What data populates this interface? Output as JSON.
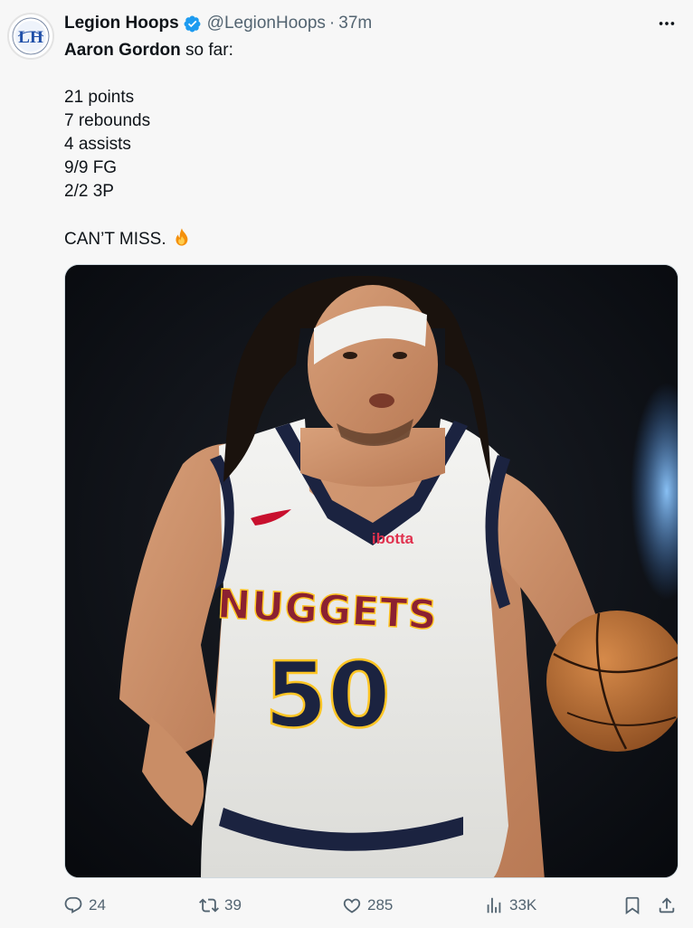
{
  "author": {
    "display_name": "Legion Hoops",
    "handle": "@LegionHoops",
    "separator": "·",
    "time": "37m",
    "avatar_icon": "legion-hoops-logo",
    "avatar_monogram": "LH",
    "verified": true
  },
  "tweet": {
    "intro_bold": "Aaron Gordon",
    "intro_rest": " so far:",
    "stats": [
      "21 points",
      "7 rebounds",
      "4 assists",
      "9/9 FG",
      "2/2 3P"
    ],
    "closing": "CAN’T MISS.",
    "closing_emoji": "fire-icon"
  },
  "media": {
    "type": "photo",
    "jersey_team": "NUGGETS",
    "jersey_number": "50",
    "jersey_sponsor": "ibotta"
  },
  "actions": {
    "replies": "24",
    "reposts": "39",
    "likes": "285",
    "views": "33K"
  },
  "colors": {
    "text": "#0f1419",
    "muted": "#536471",
    "verified": "#1d9bf0",
    "jersey_navy": "#1b2340",
    "jersey_red": "#8b2131",
    "jersey_gold": "#fec524"
  }
}
